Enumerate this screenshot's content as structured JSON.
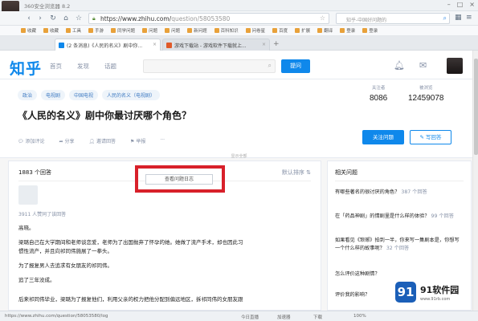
{
  "browser": {
    "window_title": "360安全浏览器 8.2",
    "url_host": "https://www.zhihu.com/",
    "url_path": "question/58053580",
    "search_placeholder": "知乎-中国好问题的",
    "bookmarks": [
      "收藏",
      "收藏",
      "工具",
      "手游",
      "同学问题",
      "问题",
      "问题",
      "新问题",
      "百科知识",
      "问卷星",
      "百度",
      "扩展",
      "翻译",
      "登录",
      "登录"
    ],
    "tabs": [
      {
        "label": "(2 条消息)《人民的名义》剧中你..."
      },
      {
        "label": "游戏下载站 - 游戏软件下载就上..."
      }
    ],
    "status_url": "https://www.zhihu.com/question/58053580/log",
    "status_items": [
      "今日直播",
      "加速器",
      "下载",
      "100%"
    ]
  },
  "zhihu": {
    "logo": "知乎",
    "nav": [
      "首页",
      "发现",
      "话题"
    ],
    "ask_label": "提问"
  },
  "question": {
    "topics": [
      "政治",
      "电视剧",
      "中国电视",
      "人民的名义（电视剧）"
    ],
    "title": "《人民的名义》剧中你最讨厌哪个角色？",
    "followers_label": "关注者",
    "followers": "8086",
    "views_label": "被浏览",
    "views": "12459078",
    "actions": [
      "添加评论",
      "分享",
      "邀请回答",
      "举报",
      "···"
    ],
    "follow_label": "关注问题",
    "write_label": "写回答",
    "show_all": "显示全部"
  },
  "answers": {
    "count_label": "1883 个回答",
    "sort_label": "默认排序",
    "view_all_label": "查看问题日志",
    "likes_label": "3911 人赞同了该回答",
    "paragraphs": [
      "高晓。",
      "梁璐自己在大学期间和老师谈恋爱，老师为了出国抛弃了怀孕的她。她做了流产手术，却也因此习",
      "惯性流产，并且向祁同伟施展了一拳头。",
      "为了报复男人去追求有女朋友的祁同伟。",
      "追了三年没成。",
      "后来祁同伟毕业，梁璐为了报复他们，利用父亲的权力把他分配到偏远地区，拆祁同伟的女朋友跟"
    ]
  },
  "related": {
    "heading": "相关问题",
    "items": [
      {
        "q": "有哪些著名的很讨厌的角色？",
        "a": "387 个回答"
      },
      {
        "q": "在「药品神剧」的情剧里是什么样的体验？",
        "a": "99 个回答"
      },
      {
        "q": "如果看见《琅琊》拍到一半，你来写一集剧本是，你想写一个什么样的故事呢？",
        "a": "32 个回答"
      },
      {
        "q": "怎么评价这种剧情？",
        "a": ""
      },
      {
        "q": "评价我的影响？",
        "a": ""
      }
    ]
  },
  "watermark": {
    "badge": "91",
    "name": "91软件园",
    "site": "www.91rb.com"
  }
}
